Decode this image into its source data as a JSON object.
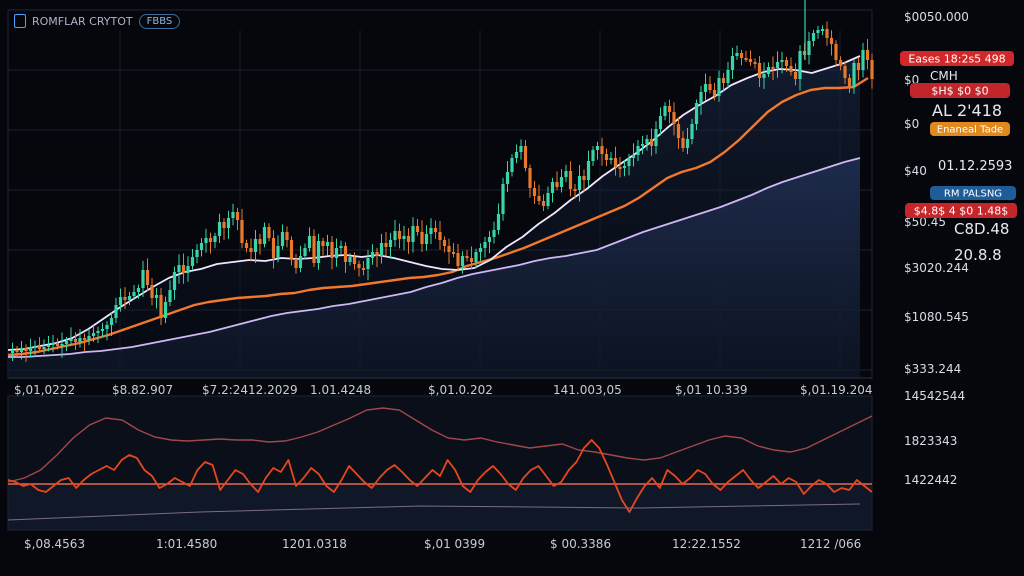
{
  "header": {
    "title": "ROMFLAR CRYTOT",
    "pill": "FBBS"
  },
  "price_axis_labels": [
    "$0050.000",
    "$0",
    "$0",
    "$40",
    "$50.45",
    "$3020.244",
    "$1080.545",
    "$333.244"
  ],
  "indicator_axis_labels": [
    "14542544",
    "1823343",
    "1422442"
  ],
  "top_date_labels": [
    "$,01,0222",
    "$8.82.907",
    "$7.2:2412.2029",
    "1.01.4248",
    "$,01.0.202",
    "141.003,05",
    "$,01 10.339",
    "$,01.19.204"
  ],
  "bottom_date_labels": [
    "$,08.4563",
    "1:01.4580",
    "1201.0318",
    "$,01 0399",
    "$ 00.3386",
    "12:22.1552",
    "1212 /066"
  ],
  "badges": [
    {
      "text": "Eases 18:2s5 498",
      "color": "#d3282a"
    },
    {
      "text": "CMH",
      "color": ""
    },
    {
      "text": "$H$ $0 $0",
      "color": "#c2262a"
    },
    {
      "text": "AL 2'418",
      "color": ""
    },
    {
      "text": "Enaneal Tade",
      "color": "#e08a1e"
    },
    {
      "text": "01.12.2593",
      "color": ""
    },
    {
      "text": "RM PALSNG",
      "color": "#1f5d99"
    },
    {
      "text": "$4.8$ 4 $0 1.48$",
      "color": "#c6252a"
    },
    {
      "text": "C8D.48",
      "color": ""
    },
    {
      "text": "20.8.8",
      "color": ""
    }
  ],
  "chart_data": [
    {
      "type": "line",
      "title": "",
      "series": [
        {
          "kind": "candlestick",
          "color_up": "#39d4a8",
          "color_down": "#e8782c",
          "values": [
            353,
            350,
            352,
            348,
            351,
            347,
            346,
            349,
            347,
            345,
            343,
            346,
            344,
            341,
            339,
            342,
            338,
            340,
            336,
            333,
            331,
            329,
            325,
            318,
            305,
            297,
            300,
            296,
            292,
            288,
            270,
            285,
            298,
            295,
            318,
            302,
            290,
            272,
            265,
            273,
            266,
            257,
            250,
            243,
            238,
            242,
            236,
            222,
            228,
            218,
            212,
            220,
            243,
            248,
            252,
            239,
            244,
            227,
            238,
            258,
            246,
            232,
            240,
            259,
            268,
            256,
            248,
            236,
            263,
            241,
            246,
            242,
            258,
            248,
            246,
            262,
            257,
            264,
            268,
            269,
            258,
            252,
            256,
            243,
            247,
            240,
            231,
            239,
            236,
            242,
            226,
            232,
            244,
            234,
            228,
            232,
            240,
            246,
            252,
            253,
            266,
            256,
            258,
            262,
            252,
            248,
            242,
            237,
            230,
            214,
            184,
            172,
            158,
            152,
            146,
            168,
            188,
            196,
            201,
            206,
            193,
            182,
            187,
            177,
            171,
            189,
            190,
            176,
            180,
            161,
            150,
            146,
            154,
            160,
            158,
            167,
            168,
            166,
            158,
            155,
            146,
            144,
            139,
            146,
            129,
            116,
            106,
            112,
            124,
            138,
            148,
            139,
            124,
            103,
            92,
            84,
            90,
            96,
            78,
            83,
            70,
            56,
            53,
            58,
            59,
            62,
            63,
            78,
            74,
            67,
            68,
            62,
            60,
            66,
            72,
            79,
            51,
            55,
            41,
            33,
            30,
            29,
            38,
            44,
            60,
            66,
            78,
            87,
            63,
            70,
            50,
            60,
            79
          ]
        },
        {
          "kind": "moving-average-fast",
          "color": "#f0e6ff",
          "values": [
            350,
            349,
            346,
            343,
            338,
            329,
            318,
            307,
            297,
            287,
            278,
            272,
            269,
            264,
            262,
            260,
            261,
            258,
            259,
            258,
            256,
            255,
            257,
            255,
            258,
            262,
            266,
            269,
            270,
            268,
            260,
            247,
            237,
            224,
            213,
            200,
            189,
            176,
            165,
            154,
            142,
            128,
            115,
            105,
            96,
            85,
            78,
            72,
            69,
            70,
            73,
            68,
            63,
            56
          ]
        },
        {
          "kind": "moving-average-mid",
          "color": "#f2782e",
          "values": [
            355,
            354,
            352,
            349,
            346,
            343,
            339,
            335,
            330,
            325,
            320,
            315,
            310,
            305,
            302,
            300,
            298,
            297,
            296,
            294,
            293,
            290,
            288,
            287,
            286,
            284,
            282,
            280,
            278,
            277,
            275,
            272,
            266,
            262,
            258,
            253,
            248,
            242,
            236,
            230,
            224,
            218,
            212,
            206,
            198,
            188,
            178,
            172,
            168,
            162,
            152,
            140,
            126,
            112,
            102,
            95,
            90,
            88,
            88,
            87,
            78
          ]
        },
        {
          "kind": "moving-average-slow",
          "color": "#cdb8f5",
          "values": [
            357,
            357,
            356,
            355,
            354,
            352,
            351,
            349,
            347,
            344,
            341,
            338,
            335,
            332,
            328,
            324,
            320,
            316,
            313,
            311,
            309,
            306,
            304,
            301,
            298,
            295,
            292,
            287,
            283,
            278,
            274,
            271,
            268,
            265,
            261,
            258,
            256,
            253,
            250,
            244,
            238,
            232,
            227,
            222,
            217,
            212,
            207,
            201,
            195,
            188,
            182,
            177,
            172,
            167,
            162,
            158
          ]
        }
      ]
    },
    {
      "type": "line",
      "title": "",
      "series": [
        {
          "kind": "oscillator",
          "color": "#e8471e",
          "values": [
            480,
            482,
            486,
            484,
            490,
            492,
            486,
            480,
            478,
            488,
            480,
            474,
            470,
            466,
            470,
            460,
            455,
            458,
            470,
            476,
            488,
            484,
            478,
            482,
            486,
            470,
            462,
            465,
            490,
            480,
            470,
            474,
            484,
            492,
            478,
            468,
            472,
            460,
            486,
            478,
            468,
            474,
            486,
            492,
            480,
            466,
            474,
            482,
            488,
            478,
            470,
            465,
            472,
            480,
            486,
            478,
            470,
            476,
            460,
            470,
            486,
            492,
            480,
            472,
            466,
            474,
            484,
            490,
            478,
            470,
            466,
            476,
            486,
            482,
            470,
            462,
            448,
            440,
            448,
            464,
            482,
            500,
            512,
            498,
            486,
            478,
            488,
            470,
            476,
            484,
            478,
            470,
            474,
            484,
            490,
            482,
            476,
            470,
            480,
            488,
            482,
            476,
            484,
            478,
            482,
            494,
            486,
            480,
            484,
            492,
            488,
            490,
            480,
            486,
            492
          ]
        },
        {
          "kind": "signal",
          "color": "#a34848",
          "values": [
            482,
            478,
            470,
            455,
            438,
            425,
            418,
            420,
            430,
            437,
            440,
            441,
            440,
            439,
            440,
            440,
            442,
            441,
            437,
            432,
            425,
            418,
            410,
            408,
            410,
            420,
            430,
            438,
            440,
            438,
            442,
            445,
            448,
            446,
            444,
            450,
            452,
            455,
            458,
            460,
            458,
            452,
            446,
            440,
            436,
            438,
            446,
            450,
            452,
            448,
            440,
            432,
            424,
            416
          ]
        },
        {
          "kind": "baseline",
          "color": "#e06a58",
          "values": [
            484
          ]
        }
      ]
    }
  ]
}
